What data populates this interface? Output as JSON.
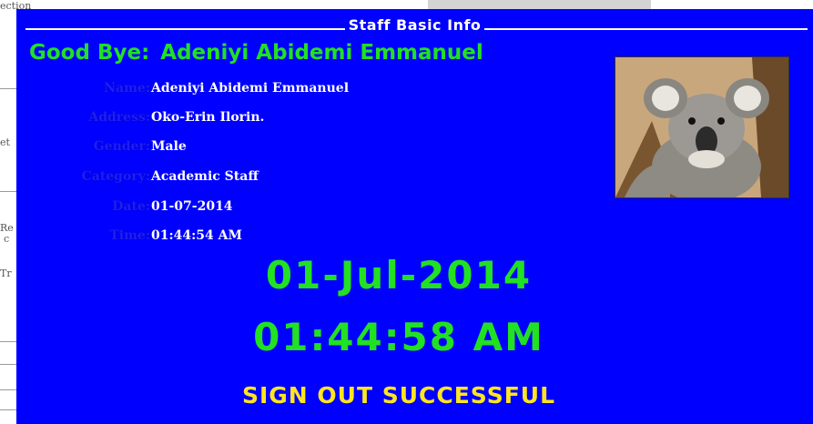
{
  "background": {
    "fragments": [
      "ection",
      "et",
      "Re",
      "c",
      "Tr"
    ]
  },
  "dialog": {
    "title": "Staff Basic Info",
    "greeting_prefix": "Good Bye:",
    "greeting_name": "Adeniyi Abidemi Emmanuel",
    "fields": [
      {
        "label": "Name:",
        "value": "Adeniyi Abidemi Emmanuel"
      },
      {
        "label": "Address:",
        "value": "Oko-Erin Ilorin."
      },
      {
        "label": "Gender:",
        "value": "Male"
      },
      {
        "label": "Category:",
        "value": "Academic Staff"
      },
      {
        "label": "Date:",
        "value": "01-07-2014"
      },
      {
        "label": "Time:",
        "value": "01:44:54 AM"
      }
    ],
    "photo_icon": "koala-photo",
    "clock_date": "01-Jul-2014",
    "clock_time": "01:44:58 AM",
    "status_message": "SIGN OUT SUCCESSFUL"
  },
  "colors": {
    "panel": "#0000ff",
    "green_text": "#22e022",
    "label_text": "#1f1ff0",
    "value_text": "#ffffff",
    "status_text": "#ffe51e"
  }
}
